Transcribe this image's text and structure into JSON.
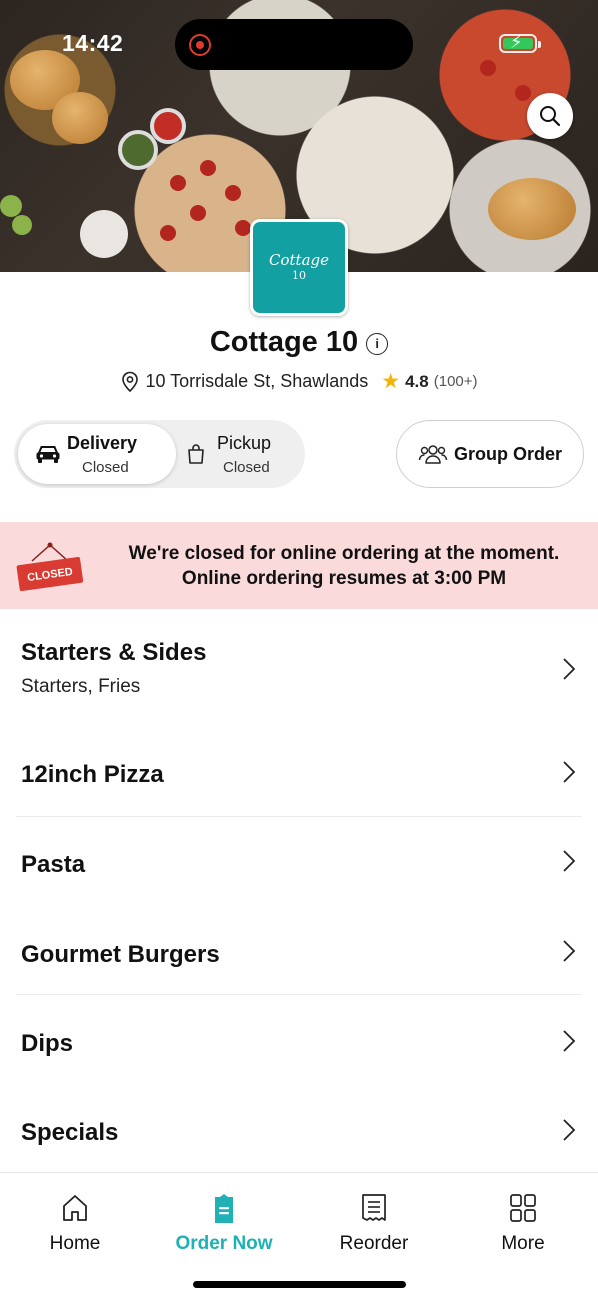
{
  "status_bar": {
    "time": "14:42"
  },
  "colors": {
    "accent": "#1fb1b3",
    "logo_bg": "#12a0a2",
    "banner_bg": "#fadadb",
    "star": "#f6b400",
    "closed_red": "#d93a32"
  },
  "store": {
    "logo_text": "Cottage",
    "logo_number": "10",
    "name": "Cottage 10",
    "address": "10 Torrisdale St, Shawlands",
    "rating": "4.8",
    "rating_count": "(100+)"
  },
  "modes": {
    "delivery": {
      "label": "Delivery",
      "status": "Closed"
    },
    "pickup": {
      "label": "Pickup",
      "status": "Closed"
    },
    "group_order": "Group Order"
  },
  "banner": {
    "sign": "CLOSED",
    "line1": "We're closed for online ordering at the moment.",
    "line2": "Online ordering resumes at 3:00 PM"
  },
  "menu": [
    {
      "title": "Starters & Sides",
      "subtitle": "Starters, Fries"
    },
    {
      "title": "12inch Pizza",
      "subtitle": ""
    },
    {
      "title": "Pasta",
      "subtitle": ""
    },
    {
      "title": "Gourmet Burgers",
      "subtitle": ""
    },
    {
      "title": "Dips",
      "subtitle": ""
    },
    {
      "title": "Specials",
      "subtitle": ""
    }
  ],
  "tabs": [
    {
      "label": "Home",
      "icon": "home-icon"
    },
    {
      "label": "Order Now",
      "icon": "order-icon"
    },
    {
      "label": "Reorder",
      "icon": "receipt-icon"
    },
    {
      "label": "More",
      "icon": "grid-icon"
    }
  ]
}
